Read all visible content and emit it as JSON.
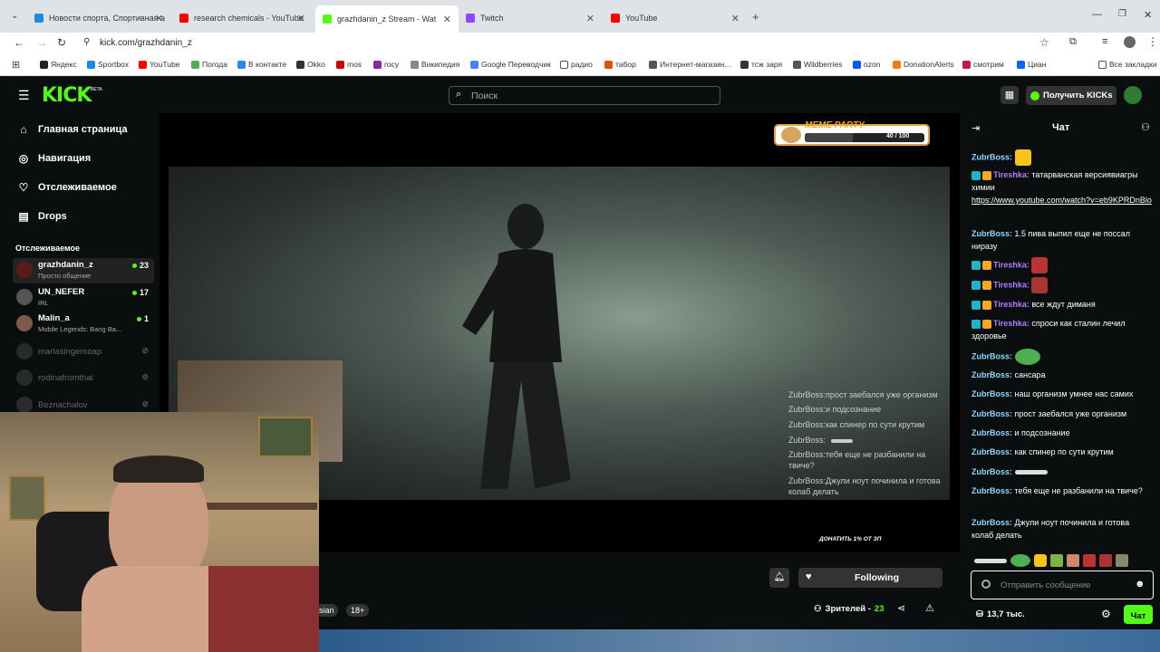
{
  "browser": {
    "tabs": [
      {
        "title": "Новости спорта, Спортивная а",
        "fav_color": "#1e88e5"
      },
      {
        "title": "research chemicals - YouTube",
        "fav_color": "#ff0000"
      },
      {
        "title": "grazhdanin_z Stream - Wat",
        "fav_color": "#53fc18"
      },
      {
        "title": "Twitch",
        "fav_color": "#9146ff"
      },
      {
        "title": "YouTube",
        "fav_color": "#ff0000"
      }
    ],
    "url": "kick.com/grazhdanin_z",
    "bookmarks": [
      "Яндекс",
      "Sportbox",
      "YouTube",
      "Погода",
      "В контакте",
      "Okko",
      "mos",
      "госу",
      "Википедия",
      "Google Переводчик",
      "радио",
      "табор",
      "Интернет-магазин...",
      "тсж заря",
      "Wildberries",
      "ozon",
      "DonationAlerts",
      "смотрим",
      "Циан"
    ],
    "all_bookmarks": "Все закладки"
  },
  "kick": {
    "logo": "KICK",
    "logo_beta": "BETA",
    "search_placeholder": "Поиск",
    "get_kicks": "Получить KICKs",
    "nav": [
      "Главная страница",
      "Навигация",
      "Отслеживаемое",
      "Drops"
    ],
    "following_header": "Отслеживаемое",
    "channels": [
      {
        "name": "grazhdanin_z",
        "sub": "Просто общение",
        "count": "23",
        "live": true
      },
      {
        "name": "UN_NEFER",
        "sub": "IRL",
        "count": "17",
        "live": true
      },
      {
        "name": "Malin_a",
        "sub": "Mobile Legends: Bang Ba...",
        "count": "1",
        "live": true
      },
      {
        "name": "marlasingersoap",
        "sub": "",
        "count": "",
        "live": false
      },
      {
        "name": "rodinafromthai",
        "sub": "",
        "count": "",
        "live": false
      },
      {
        "name": "Beznachalov",
        "sub": "",
        "count": "",
        "live": false
      }
    ],
    "meme_party": "MEME PARTY",
    "meme_progress": "40 / 100",
    "meme_progress_value": 0.4,
    "donate_text": "ДОНАТИТЬ 1% ОТ ЗП",
    "following_btn": "Following",
    "tags": [
      "sian",
      "18+"
    ],
    "viewers_label": "Зрителей -",
    "viewers_count": "23"
  },
  "overlay_chat": [
    {
      "user": "ZubrBoss:",
      "text": "прост заебался уже организм"
    },
    {
      "user": "ZubrBoss:",
      "text": "и подсознание"
    },
    {
      "user": "ZubrBoss:",
      "text": "как спинер по сути крутим"
    },
    {
      "user": "ZubrBoss:",
      "text": ""
    },
    {
      "user": "ZubrBoss:",
      "text": "тебя еще не разбанили на твиче?"
    },
    {
      "user": "ZubrBoss:",
      "text": "Джули ноут починила и готова колаб делать"
    }
  ],
  "chat": {
    "title": "Чат",
    "messages": [
      {
        "user": "ZubrBoss:",
        "text": "",
        "color": "u1"
      },
      {
        "user": "Tireshka:",
        "text": "татарванская версиявиагры химии",
        "link": "https://www.youtube.com/watch?v=eb9KPRDnBlo",
        "color": "u2"
      },
      {
        "user": "ZubrBoss:",
        "text": "1.5 пива выпил еще не поссал ниразу",
        "color": "u1"
      },
      {
        "user": "Tireshka:",
        "text": "",
        "color": "u2"
      },
      {
        "user": "Tireshka:",
        "text": "",
        "color": "u2"
      },
      {
        "user": "Tireshka:",
        "text": "все ждут диманя",
        "color": "u2"
      },
      {
        "user": "Tireshka:",
        "text": "спроси как сталин лечил здоровье",
        "color": "u2"
      },
      {
        "user": "ZubrBoss:",
        "text": "",
        "color": "u1"
      },
      {
        "user": "ZubrBoss:",
        "text": "сансара",
        "color": "u1"
      },
      {
        "user": "ZubrBoss:",
        "text": "наш организм умнее нас самих",
        "color": "u1"
      },
      {
        "user": "ZubrBoss:",
        "text": "прост заебался уже организм",
        "color": "u1"
      },
      {
        "user": "ZubrBoss:",
        "text": "и подсознание",
        "color": "u1"
      },
      {
        "user": "ZubrBoss:",
        "text": "как спинер по сути крутим",
        "color": "u1"
      },
      {
        "user": "ZubrBoss:",
        "text": "",
        "color": "u1"
      },
      {
        "user": "ZubrBoss:",
        "text": "тебя еще не разбанили на твиче?",
        "color": "u1"
      },
      {
        "user": "ZubrBoss:",
        "text": "Джули ноут починила и готова колаб делать",
        "color": "u1"
      }
    ],
    "input_placeholder": "Отправить сообщение",
    "kicks_count": "13,7 тыс.",
    "send_label": "Чат"
  }
}
